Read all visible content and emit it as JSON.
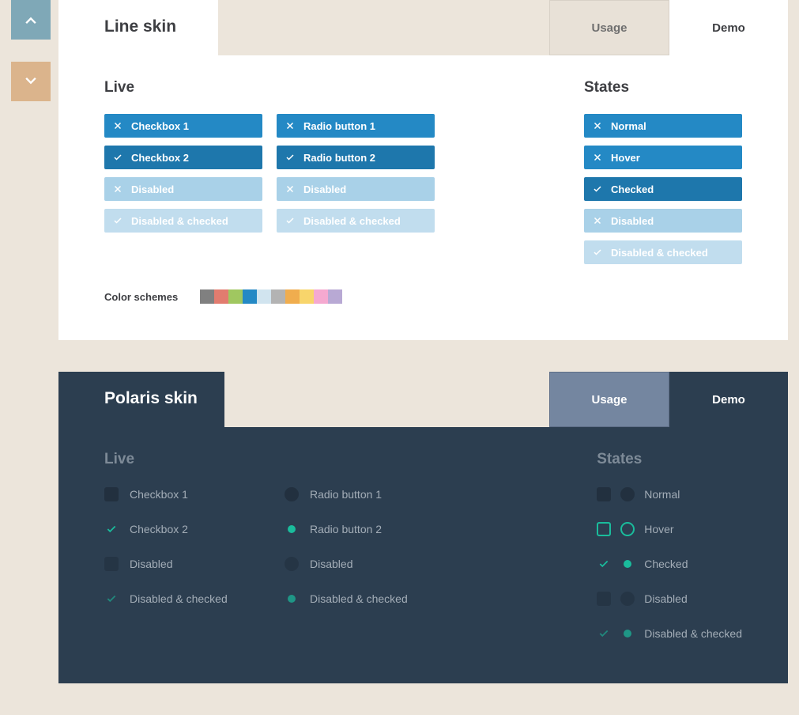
{
  "tabs": {
    "usage": "Usage",
    "demo": "Demo"
  },
  "headings": {
    "live": "Live",
    "states": "States"
  },
  "line": {
    "title": "Line skin",
    "live_checkbox": [
      {
        "label": "Checkbox 1",
        "icon": "x",
        "variant": "blue"
      },
      {
        "label": "Checkbox 2",
        "icon": "check",
        "variant": "blue-dark"
      },
      {
        "label": "Disabled",
        "icon": "x",
        "variant": "blue-light"
      },
      {
        "label": "Disabled & checked",
        "icon": "check",
        "variant": "blue-lighter"
      }
    ],
    "live_radio": [
      {
        "label": "Radio button 1",
        "icon": "x",
        "variant": "blue"
      },
      {
        "label": "Radio button 2",
        "icon": "check",
        "variant": "blue-dark"
      },
      {
        "label": "Disabled",
        "icon": "x",
        "variant": "blue-light"
      },
      {
        "label": "Disabled & checked",
        "icon": "check",
        "variant": "blue-lighter"
      }
    ],
    "states": [
      {
        "label": "Normal",
        "icon": "x",
        "variant": "blue"
      },
      {
        "label": "Hover",
        "icon": "x",
        "variant": "blue"
      },
      {
        "label": "Checked",
        "icon": "check",
        "variant": "blue-dark"
      },
      {
        "label": "Disabled",
        "icon": "x",
        "variant": "blue-light"
      },
      {
        "label": "Disabled & checked",
        "icon": "check",
        "variant": "blue-lighter"
      }
    ],
    "schemes_label": "Color schemes",
    "schemes": [
      "#808080",
      "#e27c6f",
      "#a0c760",
      "#2489c5",
      "#d1e4ef",
      "#b3b3b3",
      "#f0ad4e",
      "#f8d56b",
      "#f5a9d0",
      "#b8a9d4"
    ]
  },
  "polaris": {
    "title": "Polaris skin",
    "live_checkbox": [
      {
        "label": "Checkbox 1",
        "state": "normal"
      },
      {
        "label": "Checkbox 2",
        "state": "checked"
      },
      {
        "label": "Disabled",
        "state": "dis"
      },
      {
        "label": "Disabled & checked",
        "state": "discheck"
      }
    ],
    "live_radio": [
      {
        "label": "Radio button 1",
        "state": "normal"
      },
      {
        "label": "Radio button 2",
        "state": "checked"
      },
      {
        "label": "Disabled",
        "state": "dis"
      },
      {
        "label": "Disabled & checked",
        "state": "discheck"
      }
    ],
    "states": [
      {
        "label": "Normal",
        "state": "normal"
      },
      {
        "label": "Hover",
        "state": "hover"
      },
      {
        "label": "Checked",
        "state": "checked"
      },
      {
        "label": "Disabled",
        "state": "dis"
      },
      {
        "label": "Disabled & checked",
        "state": "discheck"
      }
    ]
  }
}
